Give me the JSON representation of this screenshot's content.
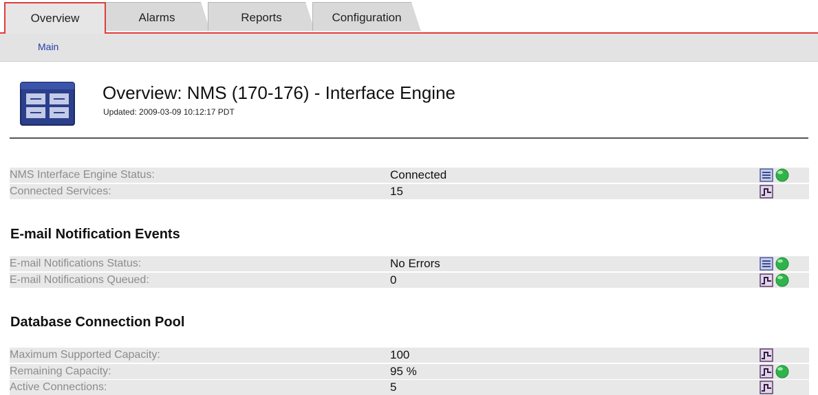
{
  "tabs": [
    {
      "label": "Overview",
      "active": true
    },
    {
      "label": "Alarms",
      "active": false
    },
    {
      "label": "Reports",
      "active": false
    },
    {
      "label": "Configuration",
      "active": false
    }
  ],
  "subnav": {
    "main_link": "Main"
  },
  "header": {
    "title": "Overview: NMS (170-176) - Interface Engine",
    "updated": "Updated: 2009-03-09 10:12:17 PDT",
    "icon": "grid-panel-icon"
  },
  "sections": [
    {
      "title": "",
      "rows": [
        {
          "label": "NMS Interface Engine Status:",
          "value": "Connected",
          "chart_icon": "table-icon",
          "status": "green"
        },
        {
          "label": "Connected Services:",
          "value": "15",
          "chart_icon": "chart-icon",
          "status": null
        }
      ]
    },
    {
      "title": "E-mail Notification Events",
      "rows": [
        {
          "label": "E-mail Notifications Status:",
          "value": "No Errors",
          "chart_icon": "table-icon",
          "status": "green"
        },
        {
          "label": "E-mail Notifications Queued:",
          "value": "0",
          "chart_icon": "chart-icon",
          "status": "green"
        }
      ]
    },
    {
      "title": "Database Connection Pool",
      "rows": [
        {
          "label": "Maximum Supported Capacity:",
          "value": "100",
          "chart_icon": "chart-icon",
          "status": null
        },
        {
          "label": "Remaining Capacity:",
          "value": "95 %",
          "chart_icon": "chart-icon",
          "status": "green"
        },
        {
          "label": "Active Connections:",
          "value": "5",
          "chart_icon": "chart-icon",
          "status": null
        }
      ]
    }
  ],
  "colors": {
    "accent": "#e23a3a",
    "link": "#1f3ea8",
    "status_green": "#2fb34a"
  }
}
